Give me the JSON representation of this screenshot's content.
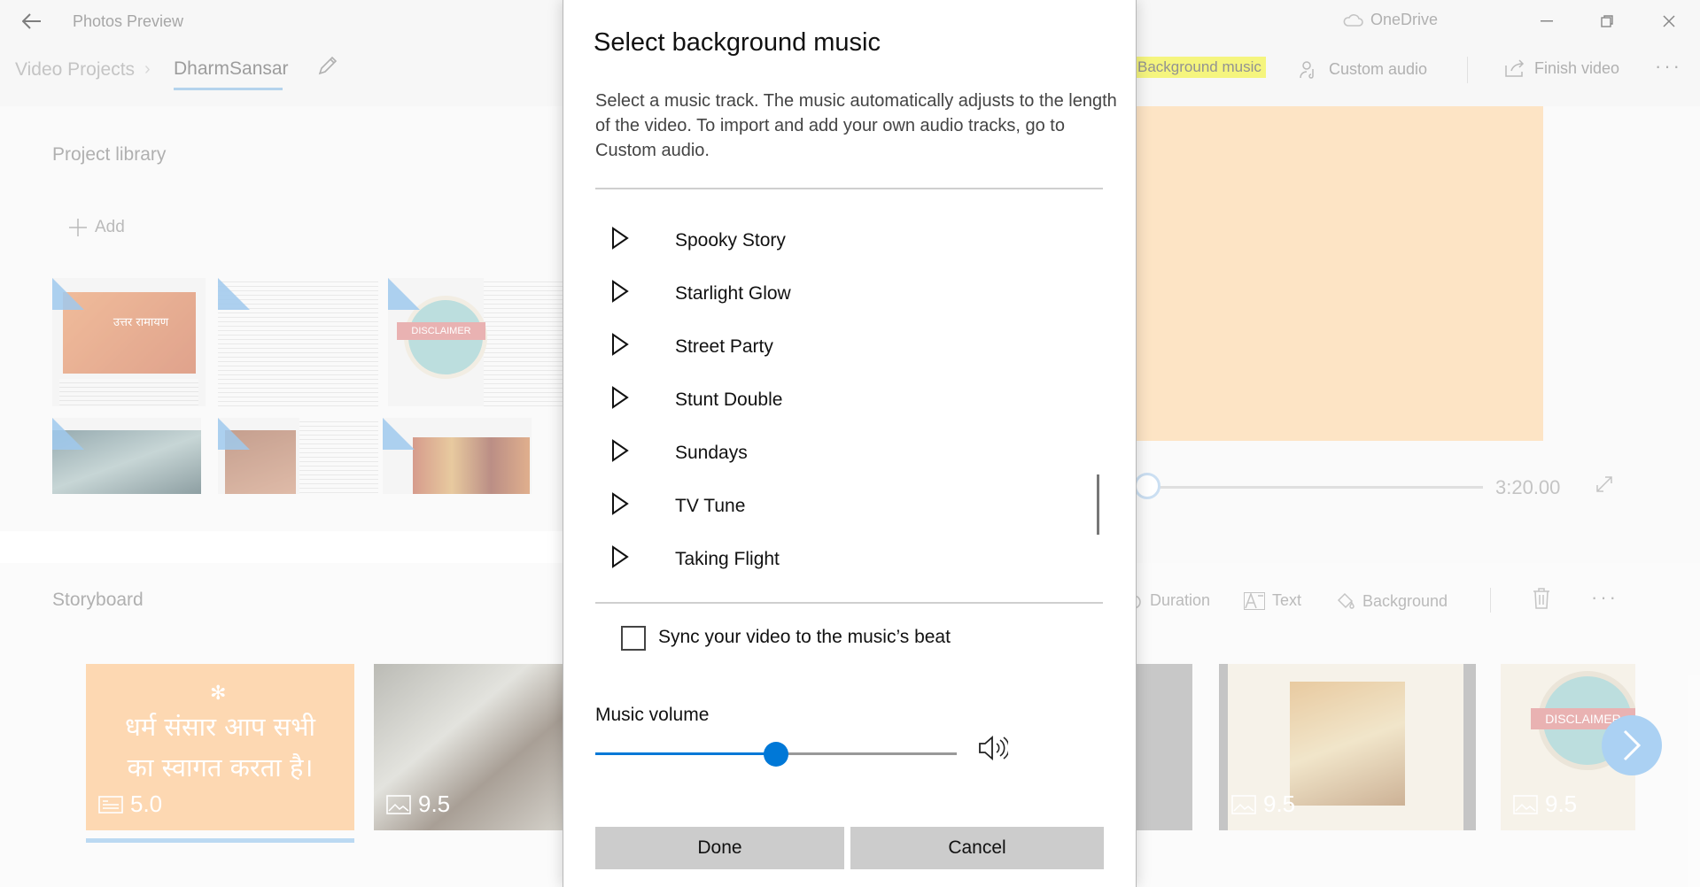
{
  "app": {
    "title": "Photos Preview",
    "back_icon": "back-arrow-icon",
    "onedrive_label": "OneDrive"
  },
  "breadcrumb": {
    "root": "Video Projects",
    "current": "DharmSansar"
  },
  "toolbar": {
    "background_music": "Background music",
    "custom_audio": "Custom audio",
    "finish_video": "Finish video"
  },
  "library": {
    "title": "Project library",
    "add_label": "Add",
    "disclaimer_text": "DISCLAIMER",
    "thumb1_text": "उत्तर रामायण"
  },
  "preview": {
    "duration": "3:20.00"
  },
  "storyboard": {
    "title": "Storyboard",
    "tools": {
      "duration": "Duration",
      "text": "Text",
      "background": "Background"
    },
    "cards": [
      {
        "hindi_line1": "धर्म संसार आप सभी",
        "hindi_line2": "का स्वागत करता है।",
        "duration": "5.0"
      },
      {
        "duration": "9.5"
      },
      {
        "duration": "9.5"
      },
      {
        "duration": "9.5",
        "disclaimer": "DISCLAIMER"
      }
    ]
  },
  "dialog": {
    "title": "Select background music",
    "description": "Select a music track. The music automatically adjusts to the length of the video. To import and add your own audio tracks, go to Custom audio.",
    "tracks": [
      "Spooky Story",
      "Starlight Glow",
      "Street Party",
      "Stunt Double",
      "Sundays",
      "TV Tune",
      "Taking Flight"
    ],
    "sync_label": "Sync your video to the music’s beat",
    "sync_checked": false,
    "volume_label": "Music volume",
    "volume_level": 0.5,
    "done_label": "Done",
    "cancel_label": "Cancel"
  },
  "colors": {
    "accent": "#0078d7",
    "highlight": "#eeee22",
    "preview_fill": "#fcd19b"
  }
}
